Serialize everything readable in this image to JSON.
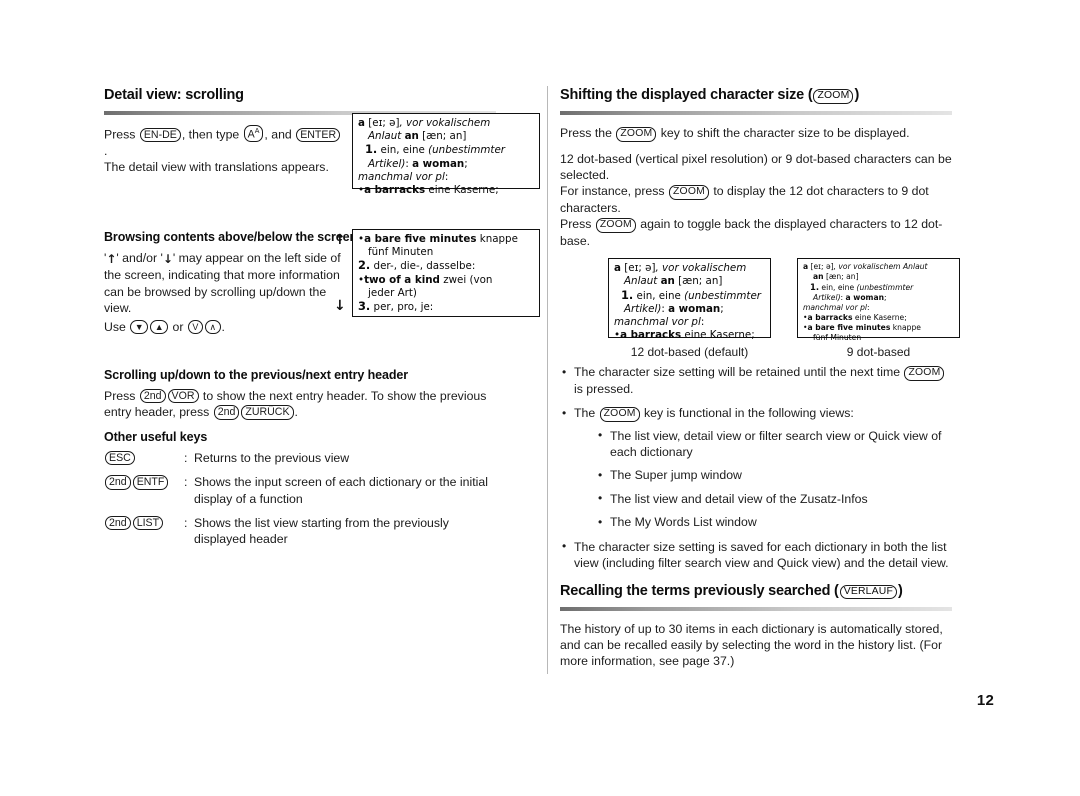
{
  "page": {
    "number": "12"
  },
  "left_column": {
    "heading": "Detail view: scrolling",
    "intro": {
      "press_label": "Press ",
      "key_en_de": "EN-DE",
      "then_type_label": ", then type ",
      "key_a": "A",
      "key_a_sup": "A",
      "and_label": ", and ",
      "key_enter": "ENTER",
      "end_label": ".",
      "line2": "The detail view with translations appears."
    },
    "browsing": {
      "heading": "Browsing contents above/below the screen",
      "quote_open": "'",
      "arrow_up": "↑",
      "and_or": "' and/or '",
      "arrow_down": "↓",
      "text_rest": "' may appear on the left side of the screen, indicating that more information can be browsed by scrolling up/down the view.",
      "use_label": "Use ",
      "key_down_filled": "▼",
      "key_up_filled": "▲",
      "or_label": " or ",
      "key_v": "V",
      "key_caret": "∧",
      "use_end": "."
    },
    "scrolling_header": {
      "heading": "Scrolling up/down to the previous/next entry header",
      "p_pre": "Press ",
      "key_2nd_a": "2nd",
      "key_vor": "VOR",
      "p_mid": " to show the next entry header. To show the previous entry header, press ",
      "key_2nd_b": "2nd",
      "key_zuruck": "ZURÜCK",
      "p_end": "."
    },
    "other_keys": {
      "heading": "Other useful keys",
      "rows": [
        {
          "keys": [
            "ESC"
          ],
          "colon": ":",
          "desc": "Returns to the previous view"
        },
        {
          "keys": [
            "2nd",
            "ENTF"
          ],
          "colon": ":",
          "desc": "Shows the input screen of each dictionary or the initial display of a function"
        },
        {
          "keys": [
            "2nd",
            "LIST"
          ],
          "colon": ":",
          "desc": "Shows the list view starting from the previously displayed header"
        }
      ]
    },
    "lcd_detail": {
      "lines": [
        "a [eɪ; ə], vor vokalischem",
        "Anlaut an [æn; an]",
        "1. ein, eine (unbestimmter",
        "Artikel): a woman;",
        "manchmal vor pl:",
        "•a barracks eine Kaserne;"
      ]
    },
    "lcd_scroll": {
      "arrow_up": "↑",
      "arrow_down": "↓",
      "lines": [
        "•a bare five minutes knappe",
        "fünf Minuten",
        "2. der-, die-, dasselbe:",
        "•two of a kind zwei (von",
        "jeder Art)",
        "3. per, pro, je:"
      ]
    }
  },
  "right_column": {
    "heading_pre": "Shifting the displayed character size (",
    "heading_key": "ZOOM",
    "heading_post": ")",
    "p1_pre": "Press the ",
    "p1_key": "ZOOM",
    "p1_post": " key to shift the character size to be displayed.",
    "p2_line1": "12 dot-based (vertical pixel resolution) or 9 dot-based characters can be selected.",
    "p2_line2_pre": "For instance, press ",
    "p2_line2_key": "ZOOM",
    "p2_line2_post": " to display the 12 dot characters to 9 dot characters.",
    "p2_line3_pre": "Press ",
    "p2_line3_key": "ZOOM",
    "p2_line3_post": " again to toggle back the displayed characters to 12 dot-base.",
    "figures": [
      {
        "caption": "12 dot-based (default)",
        "size": "12",
        "lines": [
          "a [eɪ; ə], vor vokalischem",
          "Anlaut an [æn; an]",
          "1. ein, eine (unbestimmter",
          "Artikel): a woman;",
          "manchmal vor pl:",
          "•a barracks eine Kaserne;"
        ]
      },
      {
        "caption": "9 dot-based",
        "size": "9",
        "lines": [
          "a [eɪ; ə], vor vokalischem Anlaut",
          "an [æn; an]",
          "1. ein, eine (unbestimmter",
          "Artikel): a woman;",
          "manchmal vor pl:",
          "•a barracks eine Kaserne;",
          "•a bare five minutes knappe",
          "fünf Minuten"
        ]
      }
    ],
    "bullets": [
      {
        "pre": "The character size setting will be retained until the next time ",
        "key": "ZOOM",
        "post": " is pressed."
      },
      {
        "pre": "The ",
        "key": "ZOOM",
        "post": " key is functional in the following views:",
        "sub": [
          "The list view, detail view or filter search view or Quick view of each dictionary",
          "The Super jump window",
          "The list view and detail view of the Zusatz-Infos",
          "The My Words List window"
        ]
      },
      {
        "pre": "The character size setting is saved for each dictionary in both the list view (including filter search view and Quick view) and the detail view.",
        "key": "",
        "post": ""
      }
    ],
    "recall": {
      "heading_pre": "Recalling the terms previously searched (",
      "heading_key": "VERLAUF",
      "heading_post": ")",
      "body": "The history of up to 30 items in each dictionary is automatically stored, and can be recalled easily by selecting the word in the history list. (For more information, see page 37.)"
    }
  }
}
